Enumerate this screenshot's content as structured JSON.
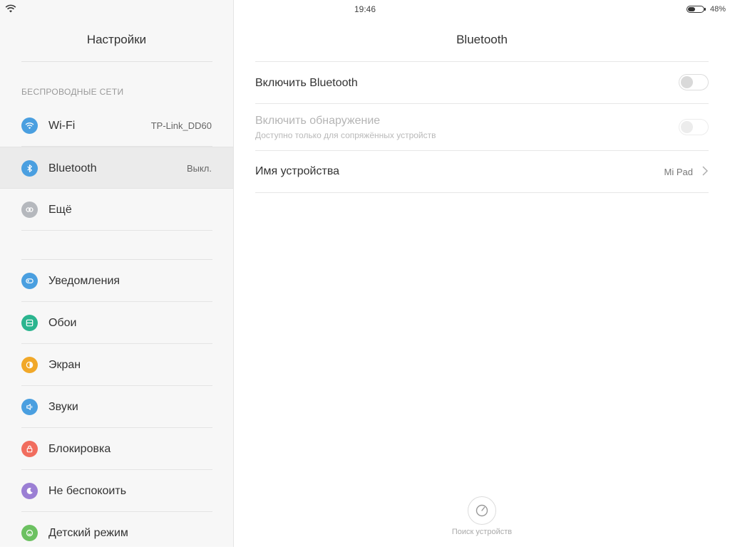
{
  "status_bar": {
    "time": "19:46",
    "battery_percent": "48%",
    "battery_level": 0.48
  },
  "left": {
    "title": "Настройки",
    "section_header": "БЕСПРОВОДНЫЕ СЕТИ",
    "wireless_items": [
      {
        "label": "Wi-Fi",
        "value": "TP-Link_DD60",
        "icon": "wifi-icon",
        "color": "#4a9fe0"
      },
      {
        "label": "Bluetooth",
        "value": "Выкл.",
        "icon": "bluetooth-icon",
        "color": "#4a9fe0"
      },
      {
        "label": "Ещё",
        "value": "",
        "icon": "link-icon",
        "color": "#b5b8bd"
      }
    ],
    "device_items": [
      {
        "label": "Уведомления",
        "icon": "notification-icon",
        "color": "#4a9fe0"
      },
      {
        "label": "Обои",
        "icon": "wallpaper-icon",
        "color": "#2bb58f"
      },
      {
        "label": "Экран",
        "icon": "display-icon",
        "color": "#f1a829"
      },
      {
        "label": "Звуки",
        "icon": "sound-icon",
        "color": "#4a9fe0"
      },
      {
        "label": "Блокировка",
        "icon": "lock-icon",
        "color": "#f16d5e"
      },
      {
        "label": "Не беспокоить",
        "icon": "moon-icon",
        "color": "#9b7fd4"
      },
      {
        "label": "Детский режим",
        "icon": "child-mode-icon",
        "color": "#6cc161"
      }
    ]
  },
  "right": {
    "title": "Bluetooth",
    "enable_bluetooth": "Включить Bluetooth",
    "enable_discovery": "Включить обнаружение",
    "discovery_subtitle": "Доступно только для сопряжённых устройств",
    "device_name_label": "Имя устройства",
    "device_name_value": "Mi Pad",
    "scan_label": "Поиск устройств"
  }
}
